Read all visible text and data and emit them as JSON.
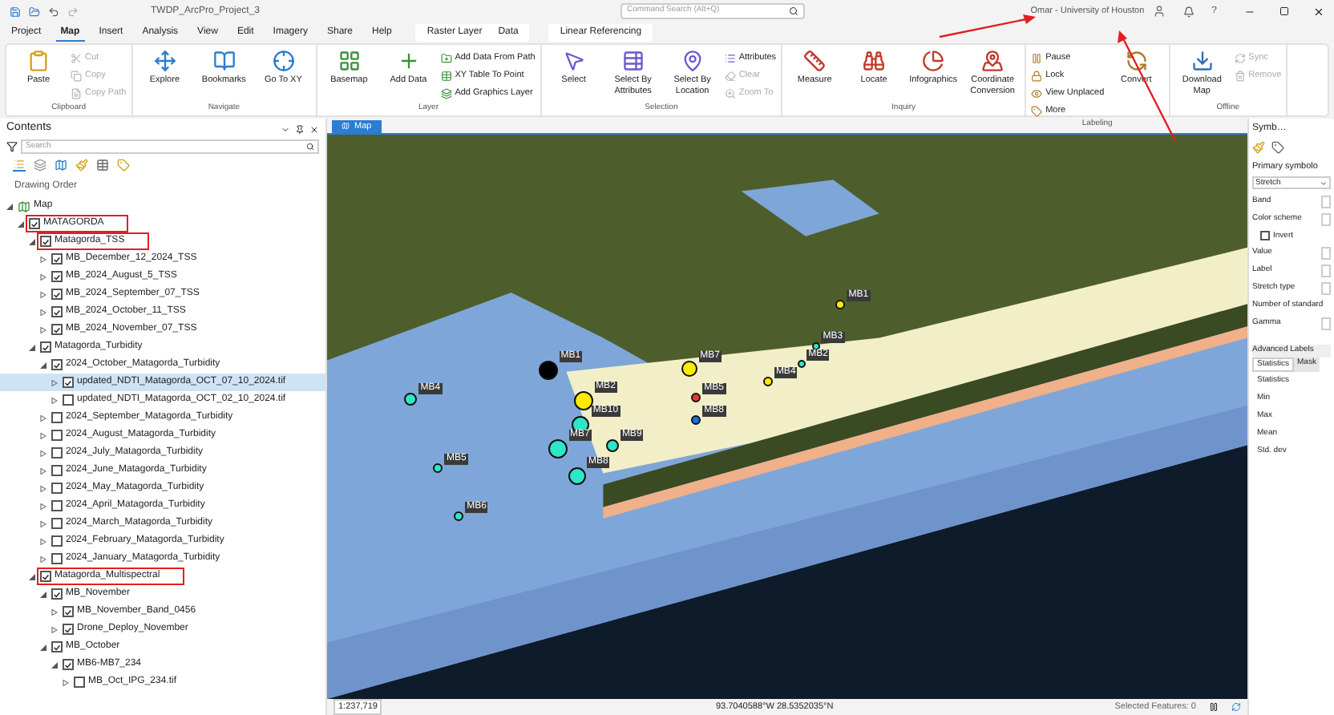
{
  "title_bar": {
    "project": "TWDP_ArcPro_Project_3",
    "search": {
      "placeholder": "Command Search (Alt+Q)"
    },
    "user": "Omar - University of Houston",
    "help": "?"
  },
  "tab_groups": [
    {
      "kind": "core",
      "tabs": [
        {
          "label": "Project",
          "selected": false
        },
        {
          "label": "Map",
          "selected": true
        },
        {
          "label": "Insert",
          "selected": false
        },
        {
          "label": "Analysis",
          "selected": false
        },
        {
          "label": "View",
          "selected": false
        },
        {
          "label": "Edit",
          "selected": false
        },
        {
          "label": "Imagery",
          "selected": false
        },
        {
          "label": "Share",
          "selected": false
        },
        {
          "label": "Help",
          "selected": false
        }
      ]
    },
    {
      "kind": "contextual",
      "tabs": [
        {
          "label": "Raster Layer",
          "selected": false
        },
        {
          "label": "Data",
          "selected": false
        }
      ]
    },
    {
      "kind": "contextual",
      "tabs": [
        {
          "label": "Linear Referencing",
          "selected": false
        }
      ]
    }
  ],
  "ribbon": [
    {
      "label": "Clipboard",
      "items": [
        {
          "label": "Paste",
          "kind": "large",
          "disabled": false
        },
        {
          "label": "Cut",
          "kind": "small",
          "disabled": true
        },
        {
          "label": "Copy",
          "kind": "small",
          "disabled": true
        },
        {
          "label": "Copy Path",
          "kind": "small",
          "disabled": true
        }
      ]
    },
    {
      "label": "Navigate",
      "items": [
        {
          "label": "Explore",
          "kind": "large",
          "disabled": false
        },
        {
          "label": "Bookmarks",
          "kind": "large",
          "disabled": false
        },
        {
          "label": "Go To XY",
          "kind": "large",
          "disabled": false
        }
      ]
    },
    {
      "label": "Layer",
      "items": [
        {
          "label": "Basemap",
          "kind": "large",
          "disabled": false
        },
        {
          "label": "Add Data",
          "kind": "large",
          "disabled": false
        },
        {
          "label": "Add Data From Path",
          "kind": "small",
          "disabled": false
        },
        {
          "label": "XY Table To Point",
          "kind": "small",
          "disabled": false
        },
        {
          "label": "Add Graphics Layer",
          "kind": "small",
          "disabled": false
        }
      ]
    },
    {
      "label": "Selection",
      "items": [
        {
          "label": "Select",
          "kind": "large",
          "disabled": false
        },
        {
          "label": "Select By Attributes",
          "kind": "large",
          "disabled": false
        },
        {
          "label": "Select By Location",
          "kind": "large",
          "disabled": false
        },
        {
          "label": "Attributes",
          "kind": "small",
          "disabled": false
        },
        {
          "label": "Clear",
          "kind": "small",
          "disabled": true
        },
        {
          "label": "Zoom To",
          "kind": "small",
          "disabled": true
        }
      ]
    },
    {
      "label": "Inquiry",
      "items": [
        {
          "label": "Measure",
          "kind": "large",
          "disabled": false
        },
        {
          "label": "Locate",
          "kind": "large",
          "disabled": false
        },
        {
          "label": "Infographics",
          "kind": "large",
          "disabled": false
        },
        {
          "label": "Coordinate Conversion",
          "kind": "large",
          "disabled": false
        }
      ]
    },
    {
      "label": "Labeling",
      "items": [
        {
          "label": "Pause",
          "kind": "small",
          "disabled": false
        },
        {
          "label": "Lock",
          "kind": "small",
          "disabled": false
        },
        {
          "label": "View Unplaced",
          "kind": "small",
          "disabled": false
        },
        {
          "label": "More",
          "kind": "small",
          "disabled": false
        },
        {
          "label": "Convert",
          "kind": "large",
          "disabled": false
        }
      ]
    },
    {
      "label": "Offline",
      "items": [
        {
          "label": "Download Map",
          "kind": "large",
          "disabled": false
        },
        {
          "label": "Sync",
          "kind": "small",
          "disabled": true
        },
        {
          "label": "Remove",
          "kind": "small",
          "disabled": true
        }
      ]
    }
  ],
  "contents": {
    "title": "Contents",
    "search": {
      "placeholder": "Search"
    },
    "heading": "Drawing Order",
    "tree": [
      {
        "kind": "map",
        "label": "Map",
        "expanded": true,
        "selected": false,
        "children": [
          {
            "kind": "layer",
            "label": "MATAGORDA",
            "checked": true,
            "expanded": true,
            "selected": false,
            "annotated": true,
            "children": [
              {
                "kind": "layer",
                "label": "Matagorda_TSS",
                "checked": true,
                "expanded": true,
                "selected": false,
                "annotated": true,
                "children": [
                  {
                    "kind": "layer",
                    "label": "MB_December_12_2024_TSS",
                    "checked": true,
                    "expanded": false,
                    "selected": false,
                    "annotated": false
                  },
                  {
                    "kind": "layer",
                    "label": "MB_2024_August_5_TSS",
                    "checked": true,
                    "expanded": false,
                    "selected": false,
                    "annotated": false
                  },
                  {
                    "kind": "layer",
                    "label": "MB_2024_September_07_TSS",
                    "checked": true,
                    "expanded": false,
                    "selected": false,
                    "annotated": false
                  },
                  {
                    "kind": "layer",
                    "label": "MB_2024_October_11_TSS",
                    "checked": true,
                    "expanded": false,
                    "selected": false,
                    "annotated": false
                  },
                  {
                    "kind": "layer",
                    "label": "MB_2024_November_07_TSS",
                    "checked": true,
                    "expanded": false,
                    "selected": false,
                    "annotated": false
                  }
                ]
              },
              {
                "kind": "layer",
                "label": "Matagorda_Turbidity",
                "checked": true,
                "expanded": true,
                "selected": false,
                "annotated": false,
                "children": [
                  {
                    "kind": "layer",
                    "label": "2024_October_Matagorda_Turbidity",
                    "checked": true,
                    "expanded": true,
                    "selected": false,
                    "annotated": false,
                    "children": [
                      {
                        "kind": "layer",
                        "label": "updated_NDTI_Matagorda_OCT_07_10_2024.tif",
                        "checked": true,
                        "expanded": false,
                        "selected": true,
                        "annotated": false
                      },
                      {
                        "kind": "layer",
                        "label": "updated_NDTI_Matagorda_OCT_02_10_2024.tif",
                        "checked": false,
                        "expanded": false,
                        "selected": false,
                        "annotated": false
                      }
                    ]
                  },
                  {
                    "kind": "layer",
                    "label": "2024_September_Matagorda_Turbidity",
                    "checked": false,
                    "expanded": false,
                    "selected": false,
                    "annotated": false
                  },
                  {
                    "kind": "layer",
                    "label": "2024_August_Matagorda_Turbidity",
                    "checked": false,
                    "expanded": false,
                    "selected": false,
                    "annotated": false
                  },
                  {
                    "kind": "layer",
                    "label": "2024_July_Matagorda_Turbidity",
                    "checked": false,
                    "expanded": false,
                    "selected": false,
                    "annotated": false
                  },
                  {
                    "kind": "layer",
                    "label": "2024_June_Matagorda_Turbidity",
                    "checked": false,
                    "expanded": false,
                    "selected": false,
                    "annotated": false
                  },
                  {
                    "kind": "layer",
                    "label": "2024_May_Matagorda_Turbidity",
                    "checked": false,
                    "expanded": false,
                    "selected": false,
                    "annotated": false
                  },
                  {
                    "kind": "layer",
                    "label": "2024_April_Matagorda_Turbidity",
                    "checked": false,
                    "expanded": false,
                    "selected": false,
                    "annotated": false
                  },
                  {
                    "kind": "layer",
                    "label": "2024_March_Matagorda_Turbidity",
                    "checked": false,
                    "expanded": false,
                    "selected": false,
                    "annotated": false
                  },
                  {
                    "kind": "layer",
                    "label": "2024_February_Matagorda_Turbidity",
                    "checked": false,
                    "expanded": false,
                    "selected": false,
                    "annotated": false
                  },
                  {
                    "kind": "layer",
                    "label": "2024_January_Matagorda_Turbidity",
                    "checked": false,
                    "expanded": false,
                    "selected": false,
                    "annotated": false
                  }
                ]
              },
              {
                "kind": "layer",
                "label": "Matagorda_Multispectral",
                "checked": true,
                "expanded": true,
                "selected": false,
                "annotated": true,
                "children": [
                  {
                    "kind": "layer",
                    "label": "MB_November",
                    "checked": true,
                    "expanded": true,
                    "selected": false,
                    "annotated": false,
                    "children": [
                      {
                        "kind": "layer",
                        "label": "MB_November_Band_0456",
                        "checked": true,
                        "expanded": false,
                        "selected": false,
                        "annotated": false
                      },
                      {
                        "kind": "layer",
                        "label": "Drone_Deploy_November",
                        "checked": true,
                        "expanded": false,
                        "selected": false,
                        "annotated": false
                      }
                    ]
                  },
                  {
                    "kind": "layer",
                    "label": "MB_October",
                    "checked": true,
                    "expanded": true,
                    "selected": false,
                    "annotated": false,
                    "children": [
                      {
                        "kind": "layer",
                        "label": "MB6-MB7_234",
                        "checked": true,
                        "expanded": true,
                        "selected": false,
                        "annotated": false,
                        "children": [
                          {
                            "kind": "layer",
                            "label": "MB_Oct_IPG_234.tif",
                            "checked": false,
                            "expanded": false,
                            "selected": false,
                            "annotated": false
                          }
                        ]
                      }
                    ]
                  }
                ]
              }
            ]
          }
        ]
      }
    ]
  },
  "map_view": {
    "tab": "Map",
    "points": [
      {
        "label": "MB1",
        "color": "#ffeb00"
      },
      {
        "label": "MB3",
        "color": "#2ee6c8"
      },
      {
        "label": "MB2",
        "color": "#2ee6c8"
      },
      {
        "label": "MB4",
        "color": "#ffeb00"
      },
      {
        "label": "MB7",
        "color": "#ffeb00"
      },
      {
        "label": "MB5",
        "color": "#e53935"
      },
      {
        "label": "MB8",
        "color": "#1e6fe0"
      },
      {
        "label": "MB1",
        "color": "#000000"
      },
      {
        "label": "MB2",
        "color": "#ffeb00"
      },
      {
        "label": "MB10",
        "color": "#2ee6c8"
      },
      {
        "label": "MB7",
        "color": "#2ee6c8"
      },
      {
        "label": "MB9",
        "color": "#2ee6c8"
      },
      {
        "label": "MB8",
        "color": "#2ee6c8"
      },
      {
        "label": "MB4",
        "color": "#2ee6c8"
      },
      {
        "label": "MB5",
        "color": "#2ee6c8"
      },
      {
        "label": "MB6",
        "color": "#2ee6c8"
      }
    ]
  },
  "status_bar": {
    "scale": "1:237,719",
    "coordinates": "93.7040588°W 28.5352035°N",
    "selected_features": "Selected Features: 0"
  },
  "symbology": {
    "title": "Symb…",
    "heading": "Primary symbolo",
    "method": "Stretch",
    "fields": [
      {
        "kind": "field",
        "label": "Band"
      },
      {
        "kind": "field",
        "label": "Color scheme"
      },
      {
        "kind": "checkbox",
        "label": "Invert",
        "checked": false
      },
      {
        "kind": "field",
        "label": "Value"
      },
      {
        "kind": "field",
        "label": "Label"
      },
      {
        "kind": "field",
        "label": "Stretch type"
      },
      {
        "kind": "text",
        "label": "Number of standard"
      },
      {
        "kind": "field",
        "label": "Gamma"
      }
    ],
    "section": "Advanced Labels",
    "tabs": [
      {
        "label": "Statistics",
        "selected": true
      },
      {
        "label": "Mask",
        "selected": false
      }
    ],
    "stats": [
      "Statistics",
      "Min",
      "Max",
      "Mean",
      "Std. dev"
    ]
  }
}
